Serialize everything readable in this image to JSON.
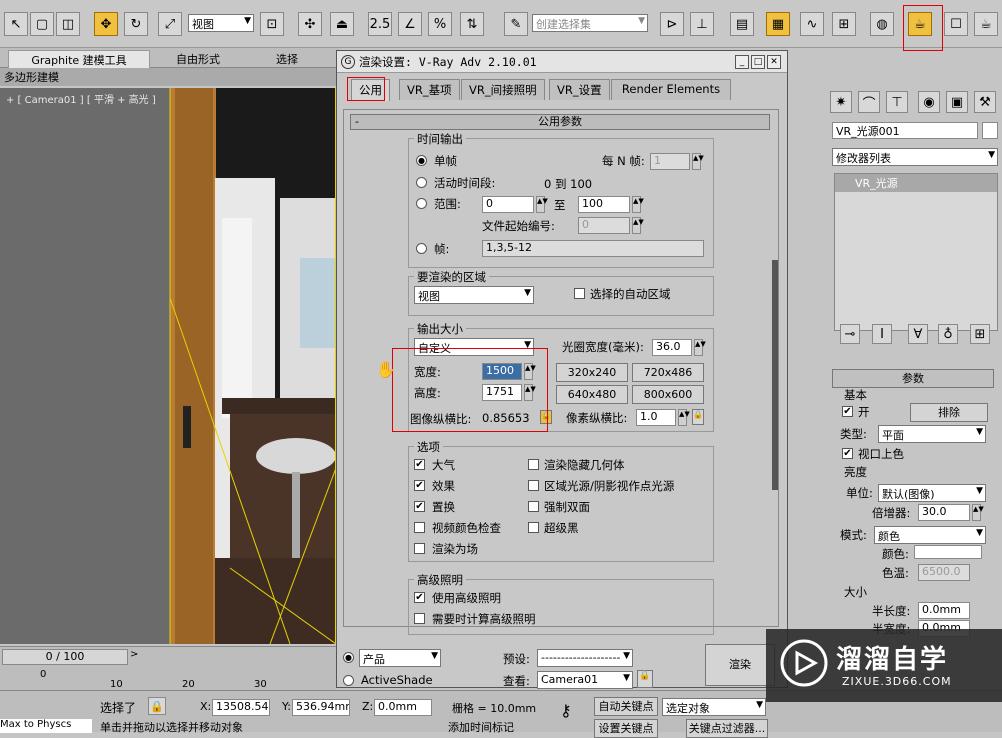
{
  "toolbar": {
    "view_select": "视图",
    "selection_set": "创建选择集"
  },
  "ribbon": {
    "tabs": [
      "Graphite 建模工具",
      "自由形式",
      "选择"
    ],
    "sub_label": "多边形建模"
  },
  "viewport": {
    "label": "+ [ Camera01 ] [ 平滑 + 高光 ]"
  },
  "dialog": {
    "title": "渲染设置: V-Ray Adv 2.10.01",
    "tabs": [
      "公用",
      "VR_基项",
      "VR_间接照明",
      "VR_设置",
      "Render Elements"
    ],
    "section": "公用参数",
    "time_output": {
      "title": "时间输出",
      "single": "单帧",
      "every_n_label": "每 N 帧:",
      "every_n": "1",
      "active_segment": "活动时间段:",
      "active_range": "0 到 100",
      "range_label": "范围:",
      "range_from": "0",
      "range_to_label": "至",
      "range_to": "100",
      "file_start_label": "文件起始编号:",
      "file_start": "0",
      "frames_label": "帧:",
      "frames": "1,3,5-12"
    },
    "area": {
      "title": "要渲染的区域",
      "value": "视图",
      "auto_region": "选择的自动区域"
    },
    "output_size": {
      "title": "输出大小",
      "preset": "自定义",
      "aperture_label": "光圈宽度(毫米):",
      "aperture": "36.0",
      "width_label": "宽度:",
      "width": "1500",
      "height_label": "高度:",
      "height": "1751",
      "presets": [
        "320x240",
        "720x486",
        "640x480",
        "800x600"
      ],
      "aspect_label": "图像纵横比:",
      "aspect": "0.85653",
      "pixel_aspect_label": "像素纵横比:",
      "pixel_aspect": "1.0"
    },
    "options": {
      "title": "选项",
      "items": [
        {
          "label": "大气",
          "checked": true
        },
        {
          "label": "渲染隐藏几何体",
          "checked": false
        },
        {
          "label": "效果",
          "checked": true
        },
        {
          "label": "区域光源/阴影视作点光源",
          "checked": false
        },
        {
          "label": "置换",
          "checked": true
        },
        {
          "label": "强制双面",
          "checked": false
        },
        {
          "label": "视频颜色检查",
          "checked": false
        },
        {
          "label": "超级黑",
          "checked": false
        },
        {
          "label": "渲染为场",
          "checked": false
        }
      ]
    },
    "advanced_lighting": {
      "title": "高级照明",
      "use": "使用高级照明",
      "compute": "需要时计算高级照明"
    },
    "bottom": {
      "product": "产品",
      "activeshade": "ActiveShade",
      "preset_label": "预设:",
      "preset": "--------------------",
      "view_label": "查看:",
      "view": "Camera01",
      "render_button": "渲染"
    }
  },
  "command_panel": {
    "object_name": "VR_光源001",
    "modifier_list": "修改器列表",
    "stack_item": "VR_光源",
    "params_title": "参数",
    "basic": "基本",
    "on_label": "开",
    "exclude": "排除",
    "type_label": "类型:",
    "type": "平面",
    "viewport_color": "视口上色",
    "intensity": "亮度",
    "unit_label": "单位:",
    "unit": "默认(图像)",
    "multiplier_label": "倍增器:",
    "multiplier": "30.0",
    "mode_label": "模式:",
    "mode": "颜色",
    "color_label": "颜色:",
    "temperature_label": "色温:",
    "temperature": "6500.0",
    "size": "大小",
    "half_length_label": "半长度:",
    "half_length": "0.0mm",
    "half_width_label": "半宽度:",
    "half_width": "0.0mm"
  },
  "timeline": {
    "frame": "0 / 100",
    "ticks": [
      "0",
      "10",
      "20",
      "30"
    ]
  },
  "status": {
    "selected": "选择了",
    "x": "13508.54m",
    "y": "536.94mm",
    "z": "0.0mm",
    "grid": "栅格 = 10.0mm",
    "auto_key": "自动关键点",
    "selected_obj": "选定对象",
    "set_key": "设置关键点",
    "key_filter": "关键点过滤器...",
    "add_time": "添加时间标记",
    "hint": "单击并拖动以选择并移动对象",
    "maxscript": "Max to Physcs"
  },
  "watermark": {
    "name": "溜溜自学",
    "url": "ZIXUE.3D66.COM"
  },
  "colors": {
    "highlight": "#e00000",
    "active_button": "#f0c040"
  }
}
